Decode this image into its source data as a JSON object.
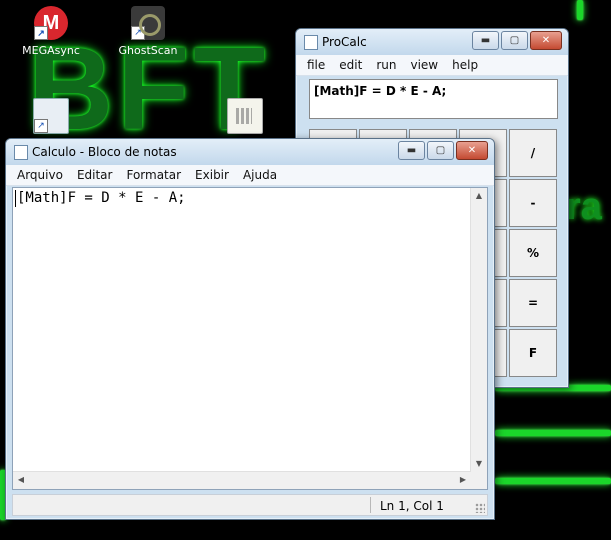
{
  "desktop": {
    "background_letters": "BFT",
    "background_tail": "ra",
    "icons": [
      {
        "label": "MEGAsync",
        "glyph": "M",
        "icon": "megasync-icon"
      },
      {
        "label": "GhostScan",
        "icon": "ghostscan-icon"
      },
      {
        "label": "",
        "icon": "shortcut-file-icon"
      },
      {
        "label": "",
        "icon": "calculator-file-icon"
      }
    ],
    "shortcut_arrow": "↗"
  },
  "procalc": {
    "title": "ProCalc",
    "menu": [
      "file",
      "edit",
      "run",
      "view",
      "help"
    ],
    "display": "[Math]F = D * E - A;",
    "keys_right": [
      "/",
      "-",
      "%",
      "=",
      "F"
    ],
    "buttons": {
      "minimize": "▬",
      "maximize": "▢",
      "close": "✕"
    }
  },
  "notepad": {
    "title": "Calculo - Bloco de notas",
    "menu": [
      "Arquivo",
      "Editar",
      "Formatar",
      "Exibir",
      "Ajuda"
    ],
    "content": "[Math]F = D * E - A;",
    "status": "Ln 1, Col 1",
    "buttons": {
      "minimize": "▬",
      "maximize": "▢",
      "close": "✕"
    },
    "scroll": {
      "up": "▲",
      "down": "▼",
      "left": "◀",
      "right": "▶"
    }
  },
  "colors": {
    "neon": "#1bd62a",
    "titlebar": "#c2d8ec",
    "close_button": "#c44a32"
  }
}
